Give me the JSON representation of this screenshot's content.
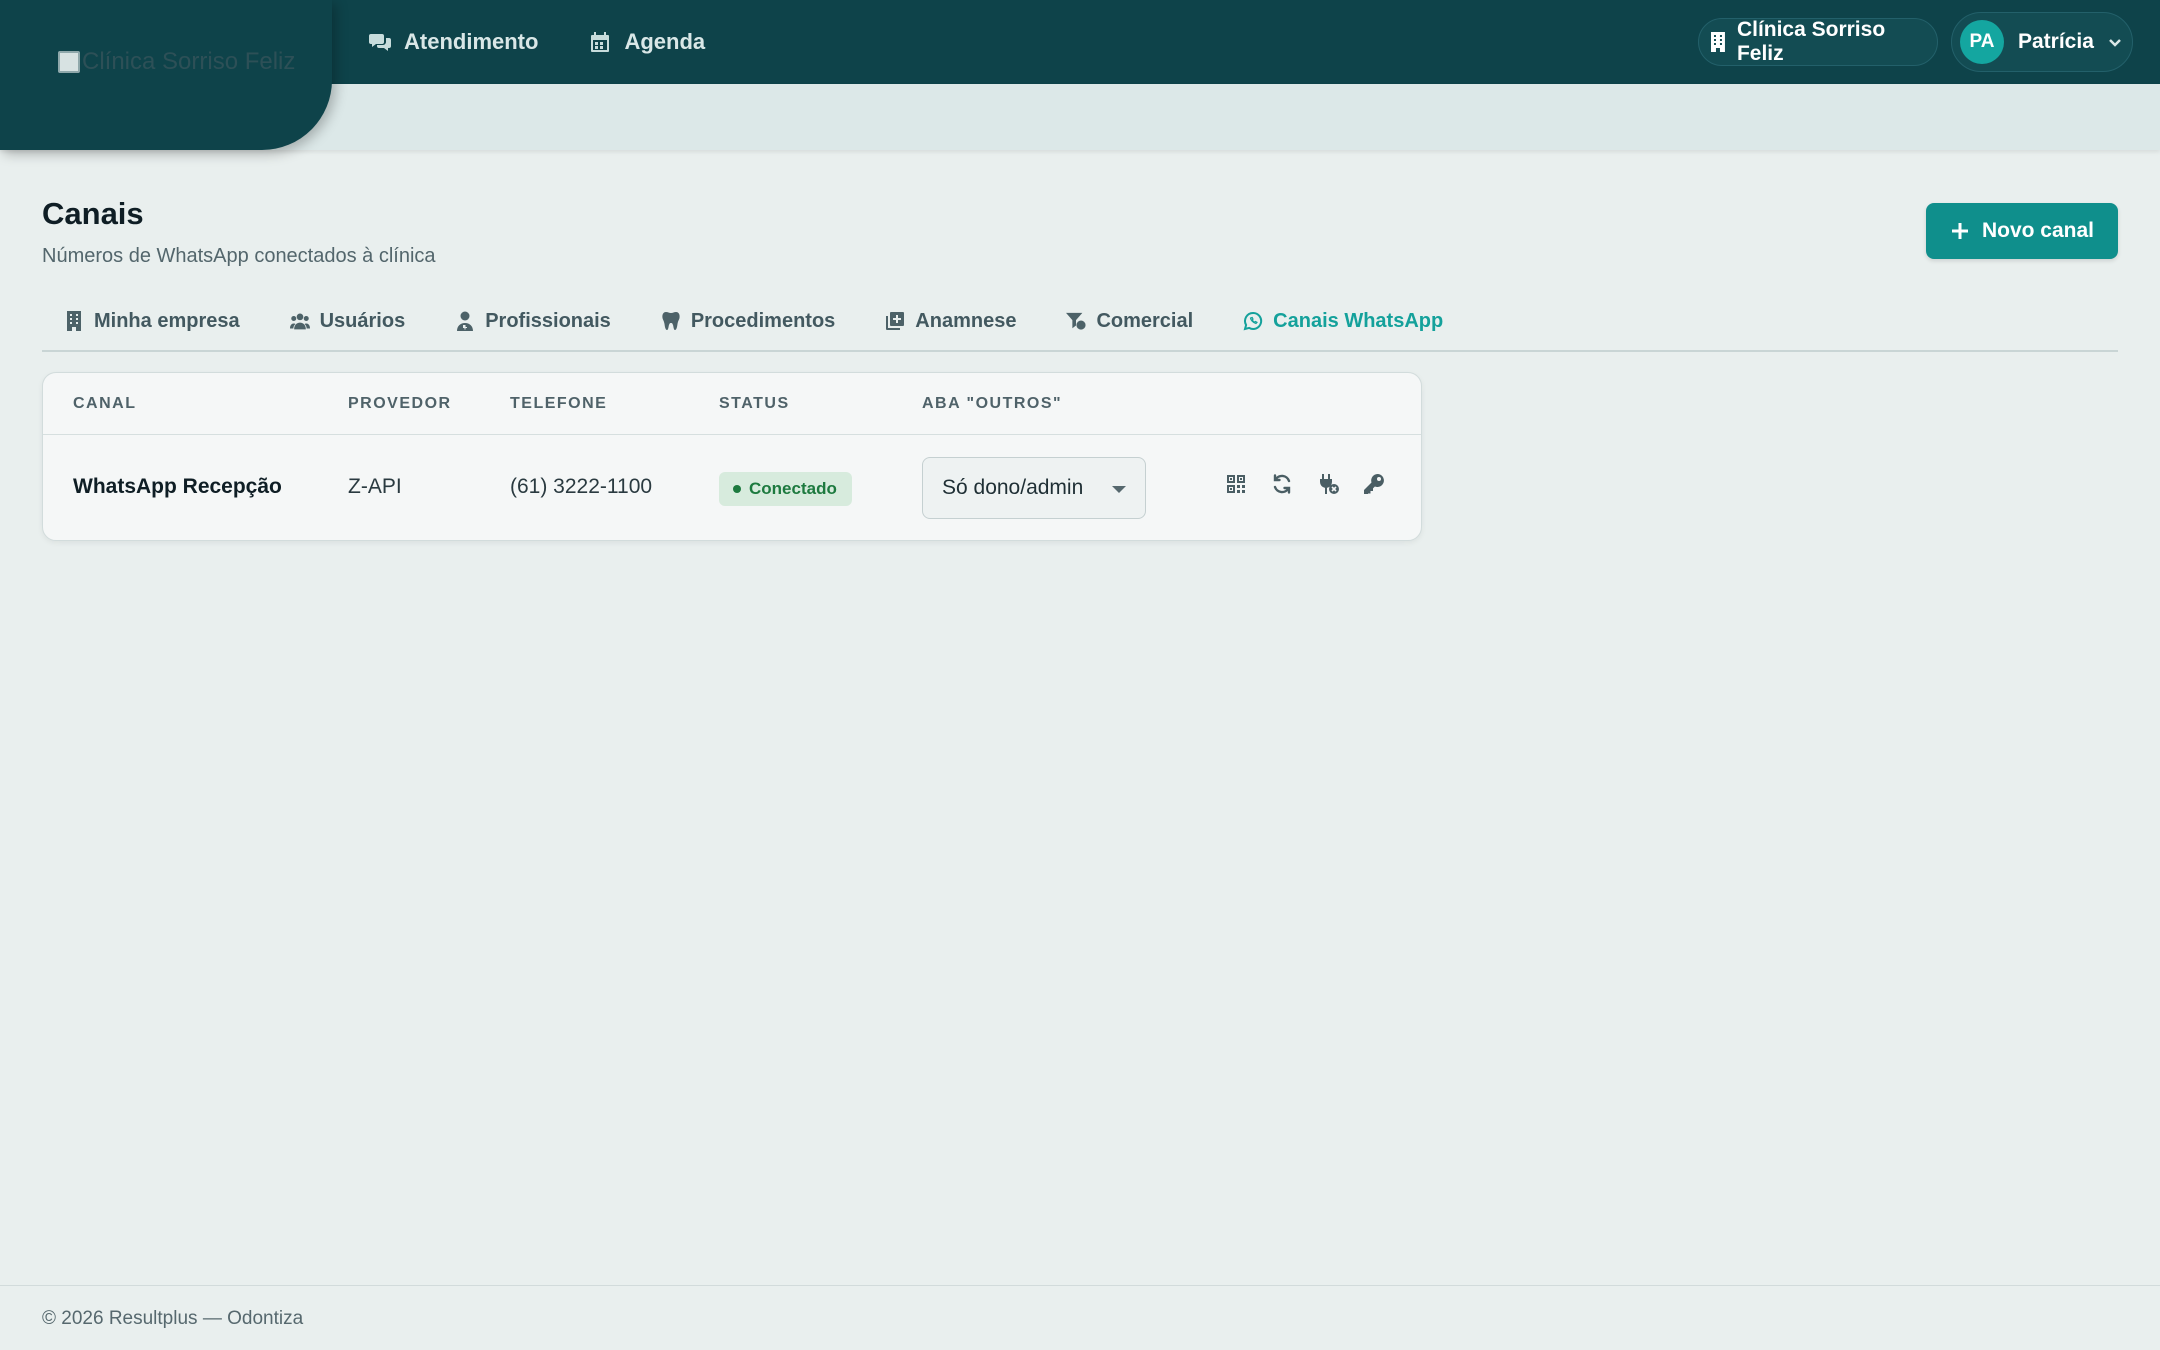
{
  "header": {
    "logo_alt": "Clínica Sorriso Feliz",
    "nav": [
      {
        "label": "Atendimento",
        "icon": "chat-bubbles-icon"
      },
      {
        "label": "Agenda",
        "icon": "calendar-icon"
      }
    ],
    "clinic_label": "Clínica Sorriso Feliz",
    "user": {
      "initials": "PA",
      "name": "Patrícia"
    }
  },
  "page": {
    "title": "Canais",
    "subtitle": "Números de WhatsApp conectados à clínica",
    "new_button_label": "Novo canal"
  },
  "tabs": [
    {
      "label": "Minha empresa",
      "icon": "building-icon",
      "active": false
    },
    {
      "label": "Usuários",
      "icon": "users-icon",
      "active": false
    },
    {
      "label": "Profissionais",
      "icon": "doctor-icon",
      "active": false
    },
    {
      "label": "Procedimentos",
      "icon": "tooth-icon",
      "active": false
    },
    {
      "label": "Anamnese",
      "icon": "clipboard-plus-icon",
      "active": false
    },
    {
      "label": "Comercial",
      "icon": "filter-dollar-icon",
      "active": false
    },
    {
      "label": "Canais WhatsApp",
      "icon": "whatsapp-icon",
      "active": true
    }
  ],
  "table": {
    "columns": [
      "CANAL",
      "PROVEDOR",
      "TELEFONE",
      "STATUS",
      "ABA \"OUTROS\""
    ],
    "rows": [
      {
        "canal": "WhatsApp Recepção",
        "provedor": "Z-API",
        "telefone": "(61) 3222-1100",
        "status": "Conectado",
        "aba_outros": "Só dono/admin",
        "actions": [
          "qr-code-icon",
          "refresh-icon",
          "plug-disconnect-icon",
          "key-icon"
        ]
      }
    ]
  },
  "footer": {
    "text": "© 2026 Resultplus — Odontiza"
  },
  "colors": {
    "topbar": "#0e434a",
    "accent": "#0f8f8c",
    "active_tab": "#14a19b",
    "status_bg": "#d7ebdd",
    "status_fg": "#1d7a3f"
  }
}
